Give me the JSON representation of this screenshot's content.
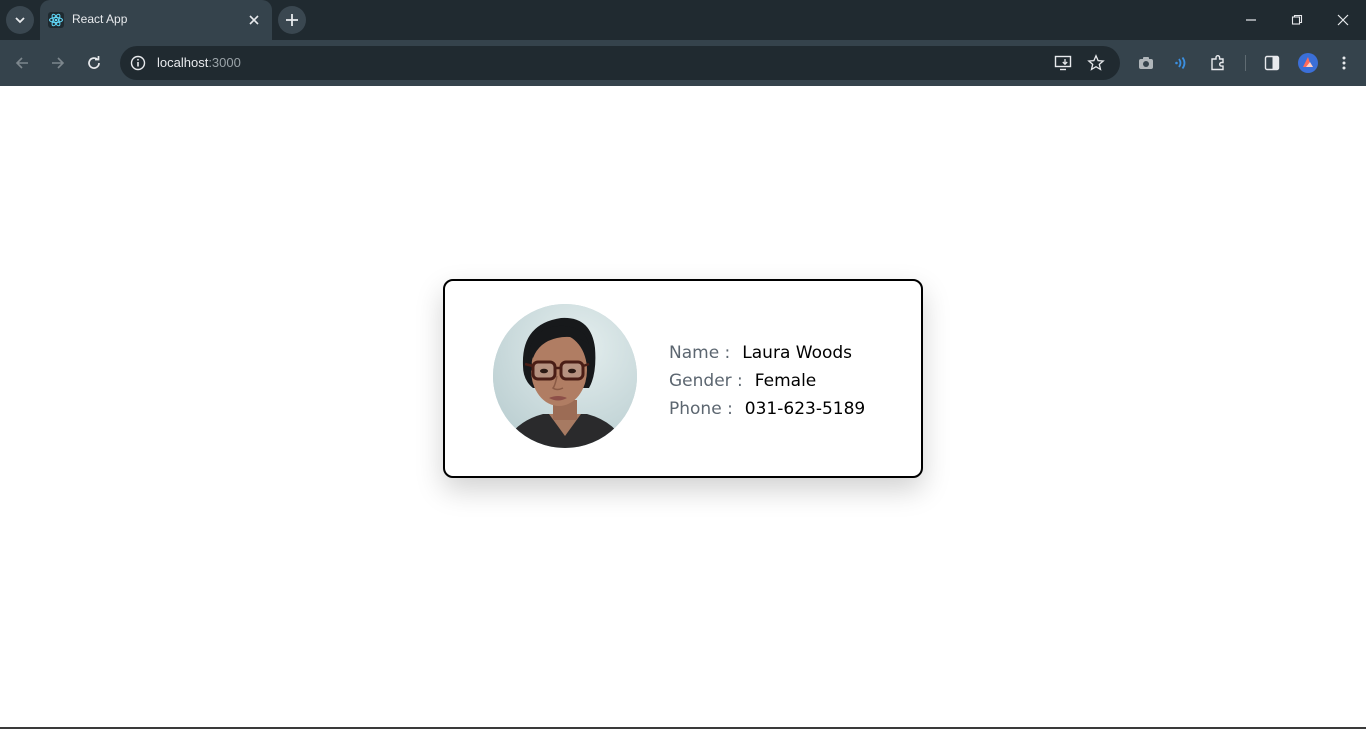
{
  "browser": {
    "tab_title": "React App",
    "url_host": "localhost",
    "url_port": ":3000"
  },
  "profile": {
    "name_label": "Name :",
    "name_value": "Laura Woods",
    "gender_label": "Gender :",
    "gender_value": "Female",
    "phone_label": "Phone :",
    "phone_value": "031-623-5189"
  },
  "colors": {
    "titlebar": "#202a30",
    "toolbar": "#35434c",
    "label": "#5c6670",
    "value": "#000000"
  },
  "icons": [
    "tab-search-icon",
    "react-favicon-icon",
    "close-icon",
    "plus-icon",
    "minimize-icon",
    "restore-icon",
    "back-icon",
    "forward-icon",
    "reload-icon",
    "site-info-icon",
    "install-app-icon",
    "star-icon",
    "camera-icon",
    "wifi-extension-icon",
    "extensions-icon",
    "side-panel-icon",
    "profile-avatar-icon",
    "menu-icon"
  ]
}
